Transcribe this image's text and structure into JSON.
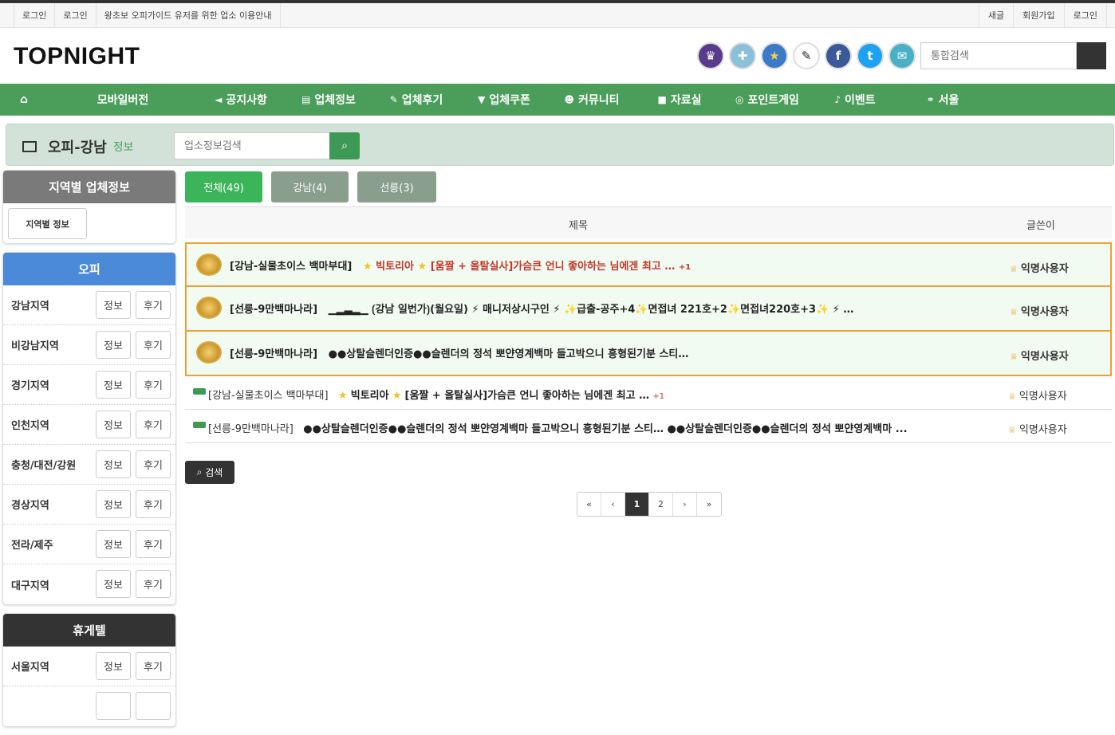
{
  "topbar": {
    "left": [
      "로그인",
      "로그인",
      "왕초보 오피가이드 유저를 위한 업소 이용안내"
    ],
    "right": [
      "새글",
      "회원가입",
      "로그인"
    ]
  },
  "logo": "TOPNIGHT",
  "search_top": {
    "placeholder": "통합검색"
  },
  "nav": [
    "",
    "모바일버전",
    "공지사항",
    "업체정보",
    "업체후기",
    "업체쿠폰",
    "커뮤니티",
    "자료실",
    "포인트게임",
    "이벤트",
    "서울"
  ],
  "subhead": {
    "title": "오피-강남",
    "sub": "정보",
    "search_placeholder": "업소정보검색"
  },
  "sidebar": {
    "region_title": "지역별 업체정보",
    "region_button": "지역별 정보",
    "opi_title": "오피",
    "opi_rows": [
      "강남지역",
      "비강남지역",
      "경기지역",
      "인천지역",
      "충청/대전/강원",
      "경상지역",
      "전라/제주",
      "대구지역"
    ],
    "hugetel_title": "휴게텔",
    "hugetel_rows": [
      "서울지역",
      ""
    ],
    "info_label": "정보",
    "review_label": "후기"
  },
  "tabs": [
    "전체(49)",
    "강남(4)",
    "선릉(3)"
  ],
  "table": {
    "col_title": "제목",
    "col_author": "글쓴이"
  },
  "premium_rows": [
    {
      "a": "[강남-실물초이스 백마부대]",
      "b": "빅토리아",
      "c": "[움짤 + 올탈실사]가슴큰 언니 좋아하는 님에겐 최고 …",
      "plus": "+1",
      "author": "익명사용자"
    },
    {
      "a": "[선릉-9만백마나라]",
      "b": "강남 일번가",
      "c": "(월요일) ⚡ 매니저상시구인 ⚡ ✨급출-공주+4✨면접녀 221호+2✨면접녀220호+3✨ ⚡ …",
      "plus": "",
      "author": "익명사용자"
    },
    {
      "a": "[선릉-9만백마나라]",
      "b": "",
      "c": "●●상탈슬렌더인증●●슬렌더의 정석 뽀얀영계백마 들고박으니 흥형된기분 스티…",
      "plus": "",
      "author": "익명사용자"
    }
  ],
  "normal_rows": [
    {
      "a": "[강남-실물초이스 백마부대]",
      "b": "빅토리아",
      "c": "[움짤 + 올탈실사]가슴큰 언니 좋아하는 님에겐 최고 …",
      "plus": "+1",
      "author": "익명사용자"
    },
    {
      "a": "[선릉-9만백마나라]",
      "b": "",
      "c": "●●상탈슬렌더인증●●슬렌더의 정석 뽀얀영계백마 들고박으니 흥형된기분 스티… ●●상탈슬렌더인증●●슬렌더의 정석 뽀얀영계백마 ...",
      "plus": "",
      "author": "익명사용자"
    }
  ],
  "search_button": "검색",
  "pager": [
    "«",
    "‹",
    "1",
    "2",
    "›",
    "»"
  ],
  "colors": {
    "green": "#4a9e5a",
    "gray_tab": "#8a9e8d",
    "blue": "#4a8ad8",
    "dark": "#333333"
  }
}
